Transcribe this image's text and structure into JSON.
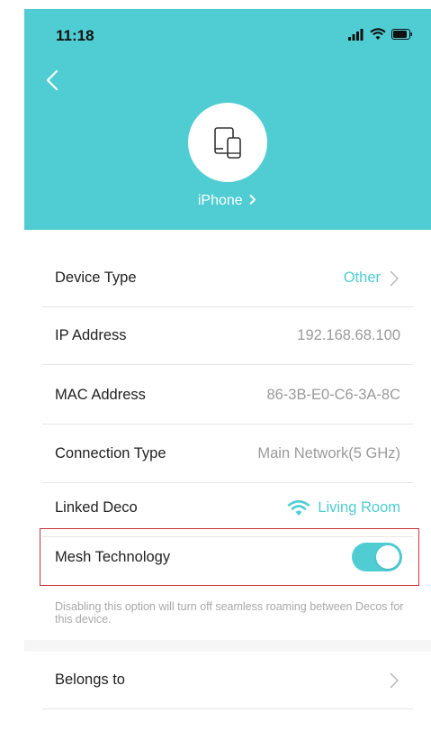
{
  "status_bar": {
    "time": "11:18"
  },
  "header": {
    "device_name": "iPhone"
  },
  "rows": [
    {
      "label": "Device Type",
      "value": "Other"
    },
    {
      "label": "IP Address",
      "value": "192.168.68.100"
    },
    {
      "label": "MAC Address",
      "value": "86-3B-E0-C6-3A-8C"
    },
    {
      "label": "Connection Type",
      "value": "Main Network(5 GHz)"
    },
    {
      "label": "Linked Deco",
      "value": "Living Room"
    },
    {
      "label": "Mesh Technology",
      "toggle_on": true
    }
  ],
  "mesh_note": "Disabling this option will turn off seamless roaming between Decos for this device.",
  "belongs_to": {
    "label": "Belongs to"
  },
  "colors": {
    "accent": "#4fcdd3",
    "highlight_border": "#c9333b"
  },
  "icons": [
    "back-arrow-icon",
    "devices-icon",
    "chevron-right-icon",
    "wifi-icon",
    "signal-icon",
    "battery-icon"
  ]
}
